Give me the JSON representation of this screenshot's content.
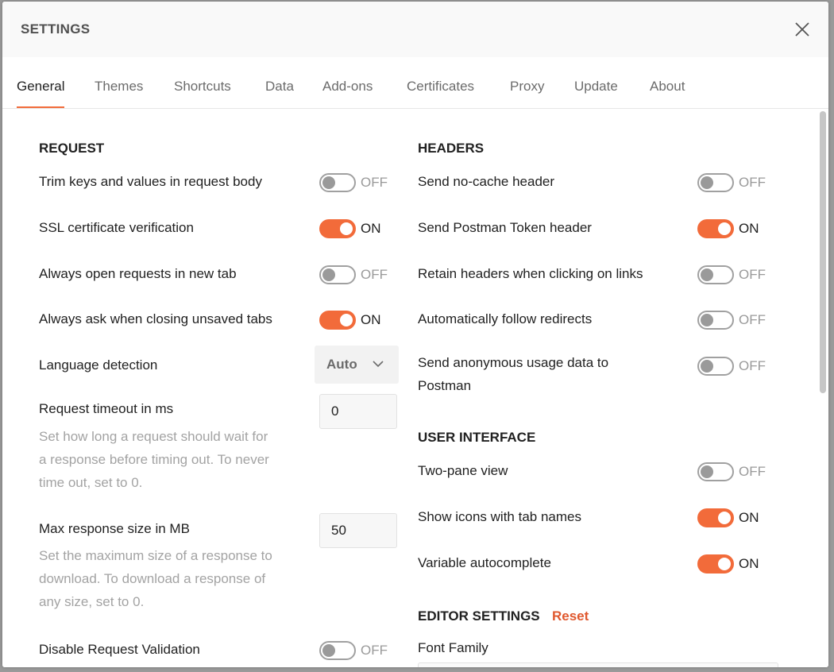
{
  "dialog": {
    "title": "SETTINGS"
  },
  "colors": {
    "accent": "#f26b3a",
    "reset": "#e0582e",
    "toggle_off": "#9a9a9a"
  },
  "icons": {
    "close": "close-icon",
    "dropdown": "chevron-down-icon"
  },
  "tabs": [
    {
      "label": "General",
      "active": true
    },
    {
      "label": "Themes",
      "active": false
    },
    {
      "label": "Shortcuts",
      "active": false
    },
    {
      "label": "Data",
      "active": false
    },
    {
      "label": "Add-ons",
      "active": false
    },
    {
      "label": "Certificates",
      "active": false
    },
    {
      "label": "Proxy",
      "active": false
    },
    {
      "label": "Update",
      "active": false
    },
    {
      "label": "About",
      "active": false
    }
  ],
  "request": {
    "title": "REQUEST",
    "trim": {
      "label": "Trim keys and values in request body",
      "state": "OFF"
    },
    "ssl": {
      "label": "SSL certificate verification",
      "state": "ON"
    },
    "new_tab": {
      "label": "Always open requests in new tab",
      "state": "OFF"
    },
    "ask_close": {
      "label": "Always ask when closing unsaved tabs",
      "state": "ON"
    },
    "language": {
      "label": "Language detection",
      "value": "Auto"
    },
    "timeout": {
      "label": "Request timeout in ms",
      "value": "0",
      "help": [
        "Set how long a request should wait for",
        "a response before timing out. To never",
        "time out, set to 0."
      ]
    },
    "max_size": {
      "label": "Max response size in MB",
      "value": "50",
      "help": [
        "Set the maximum size of a response to",
        "download. To download a response of",
        "any size, set to 0."
      ]
    },
    "disable_validation": {
      "label": "Disable Request Validation",
      "state": "OFF"
    }
  },
  "headers": {
    "title": "HEADERS",
    "no_cache": {
      "label": "Send no-cache header",
      "state": "OFF"
    },
    "postman_token": {
      "label": "Send Postman Token header",
      "state": "ON"
    },
    "retain": {
      "label": "Retain headers when clicking on links",
      "state": "OFF"
    },
    "redirects": {
      "label": "Automatically follow redirects",
      "state": "OFF"
    },
    "usage": {
      "label": [
        "Send anonymous usage data to",
        "Postman"
      ],
      "state": "OFF"
    }
  },
  "ui": {
    "title": "USER INTERFACE",
    "two_pane": {
      "label": "Two-pane view",
      "state": "OFF"
    },
    "icons": {
      "label": "Show icons with tab names",
      "state": "ON"
    },
    "autocomplete": {
      "label": "Variable autocomplete",
      "state": "ON"
    }
  },
  "editor": {
    "title": "EDITOR SETTINGS",
    "reset": "Reset",
    "font_family": {
      "label": "Font Family"
    }
  }
}
